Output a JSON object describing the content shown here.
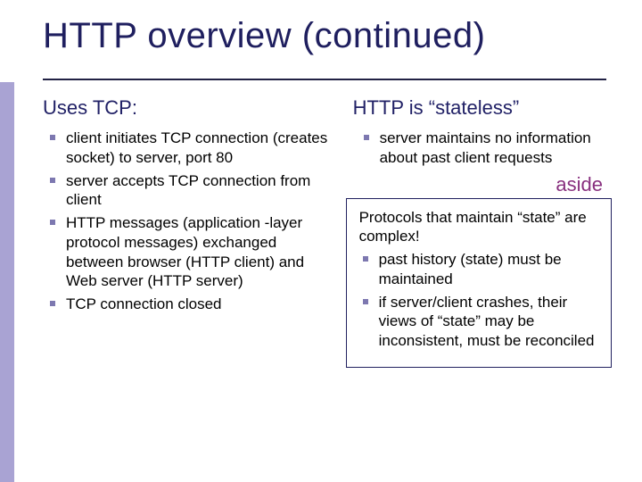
{
  "title": "HTTP overview (continued)",
  "left": {
    "heading": "Uses TCP:",
    "bullets": [
      "client initiates TCP connection (creates socket) to server, port 80",
      "server accepts TCP connection from client",
      "HTTP messages (application -layer protocol messages) exchanged between browser (HTTP client) and Web server (HTTP server)",
      "TCP connection closed"
    ]
  },
  "right": {
    "heading": "HTTP is “stateless”",
    "bullets": [
      "server maintains no information about past client requests"
    ],
    "aside_label": "aside",
    "aside": {
      "lead": "Protocols that maintain “state” are complex!",
      "bullets": [
        "past history (state) must be maintained",
        "if server/client crashes, their views of “state” may be inconsistent, must be reconciled"
      ]
    }
  }
}
